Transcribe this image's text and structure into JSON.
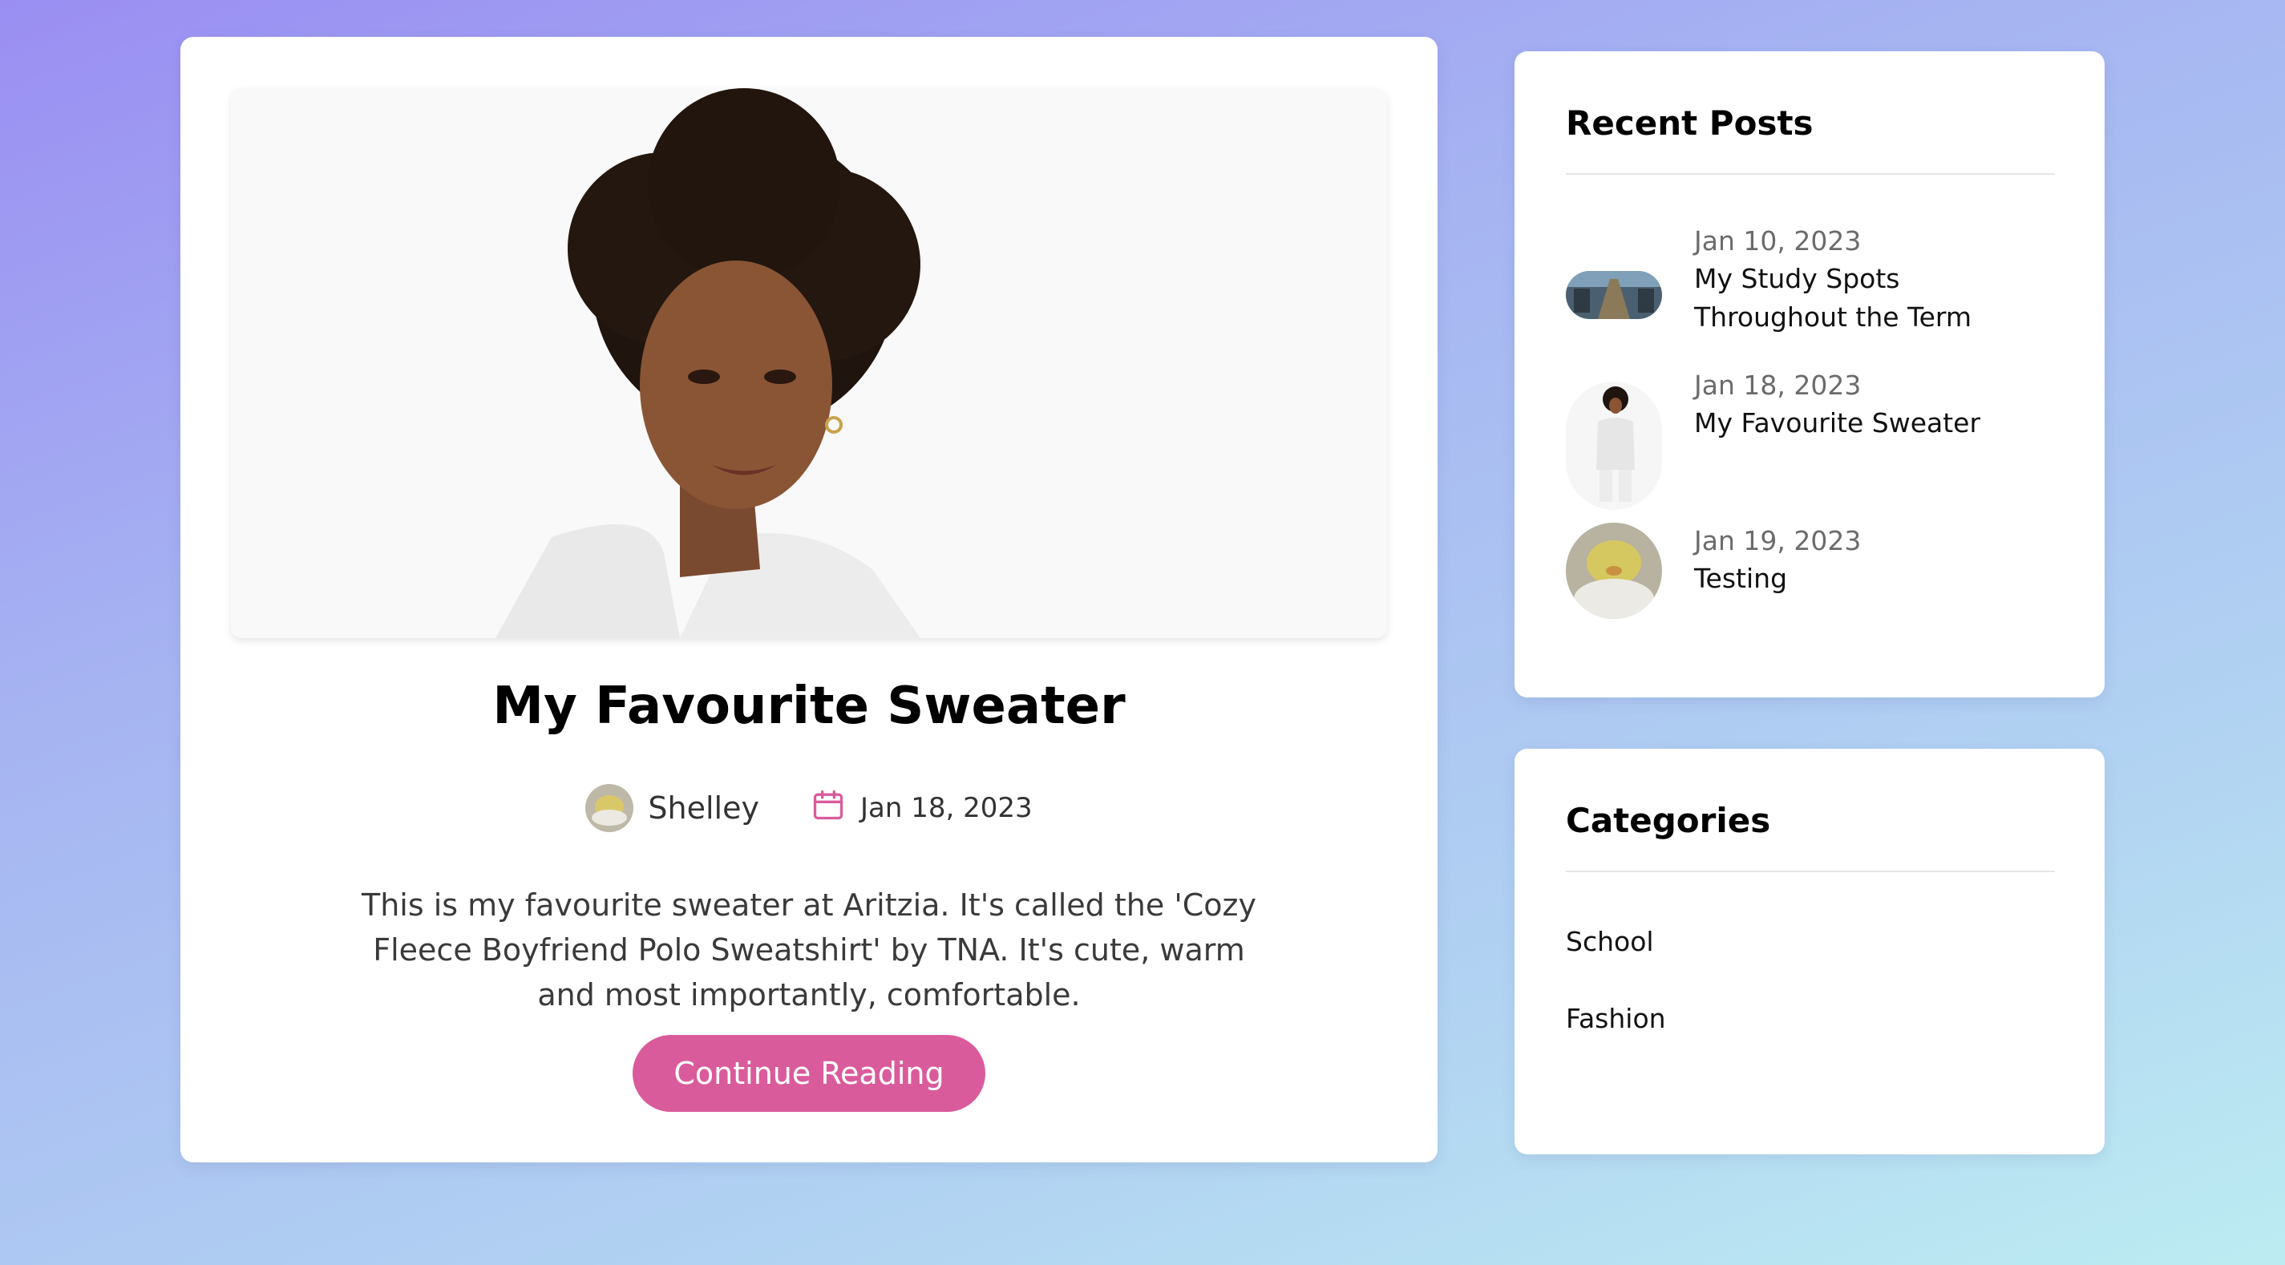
{
  "post": {
    "title": "My Favourite Sweater",
    "author": "Shelley",
    "date": "Jan 18, 2023",
    "excerpt": "This is my favourite sweater at Aritzia. It's called the 'Cozy Fleece Boyfriend Polo Sweatshirt' by TNA. It's cute, warm and most importantly, comfortable.",
    "button_label": "Continue Reading",
    "hero_image": "portrait-photo",
    "accent_color": "#da5b9c"
  },
  "recent_posts": {
    "title": "Recent Posts",
    "items": [
      {
        "date": "Jan 10, 2023",
        "title": "My Study Spots Throughout the Term",
        "thumbnail": "library-photo"
      },
      {
        "date": "Jan 18, 2023",
        "title": "My Favourite Sweater",
        "thumbnail": "sweater-photo"
      },
      {
        "date": "Jan 19, 2023",
        "title": "Testing",
        "thumbnail": "plush-duck-photo"
      }
    ]
  },
  "categories": {
    "title": "Categories",
    "items": [
      "School",
      "Fashion"
    ]
  }
}
